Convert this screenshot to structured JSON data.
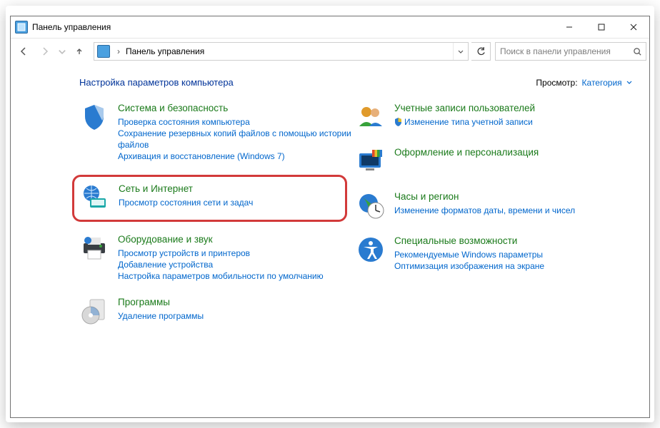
{
  "window": {
    "title": "Панель управления"
  },
  "nav": {
    "breadcrumb": "Панель управления",
    "search_placeholder": "Поиск в панели управления"
  },
  "header": {
    "heading": "Настройка параметров компьютера",
    "view_label": "Просмотр:",
    "view_value": "Категория"
  },
  "left": [
    {
      "title": "Система и безопасность",
      "links": [
        "Проверка состояния компьютера",
        "Сохранение резервных копий файлов с помощью истории файлов",
        "Архивация и восстановление (Windows 7)"
      ]
    },
    {
      "title": "Сеть и Интернет",
      "links": [
        "Просмотр состояния сети и задач"
      ]
    },
    {
      "title": "Оборудование и звук",
      "links": [
        "Просмотр устройств и принтеров",
        "Добавление устройства",
        "Настройка параметров мобильности по умолчанию"
      ]
    },
    {
      "title": "Программы",
      "links": [
        "Удаление программы"
      ]
    }
  ],
  "right": [
    {
      "title": "Учетные записи пользователей",
      "links": [
        "Изменение типа учетной записи"
      ]
    },
    {
      "title": "Оформление и персонализация",
      "links": []
    },
    {
      "title": "Часы и регион",
      "links": [
        "Изменение форматов даты, времени и чисел"
      ]
    },
    {
      "title": "Специальные возможности",
      "links": [
        "Рекомендуемые Windows параметры",
        "Оптимизация изображения на экране"
      ]
    }
  ]
}
